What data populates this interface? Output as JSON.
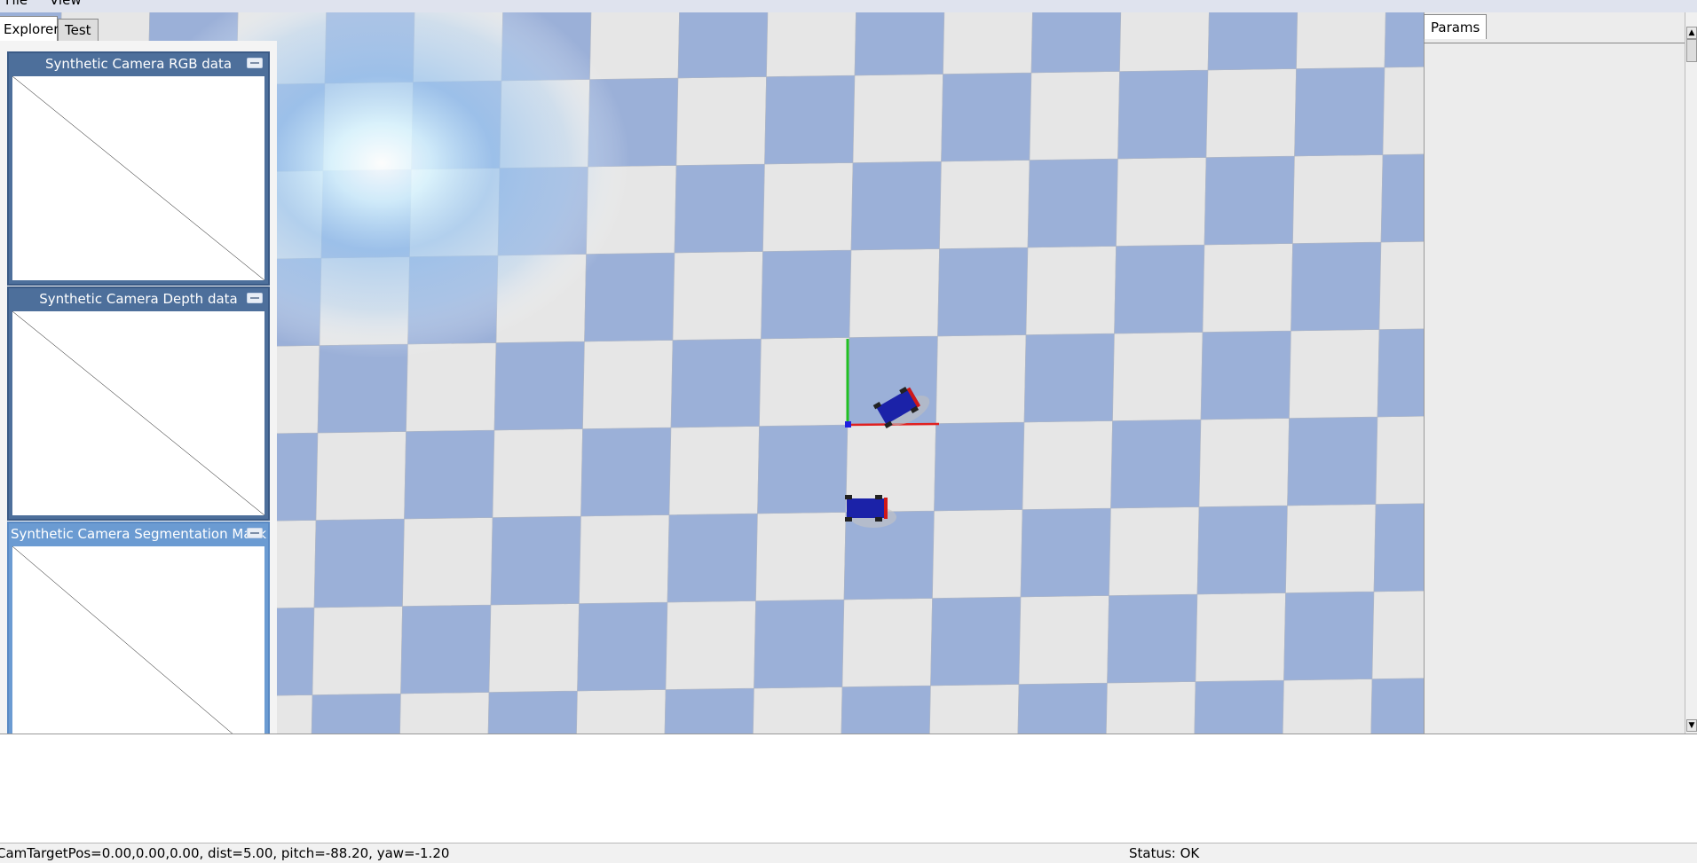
{
  "menu": {
    "items": [
      "File",
      "View"
    ]
  },
  "left_tabs": [
    "Explorer",
    "Test"
  ],
  "right_tabs": [
    "Params"
  ],
  "camera_windows": [
    {
      "title": "Synthetic Camera RGB data"
    },
    {
      "title": "Synthetic Camera Depth data"
    },
    {
      "title": "Synthetic Camera Segmentation Mask"
    }
  ],
  "status": {
    "left": "CamTargetPos=0.00,0.00,0.00, dist=5.00, pitch=-88.20, yaw=-1.20",
    "right": "Status: OK"
  },
  "colors": {
    "floor_light": "#e6e6e6",
    "floor_blue": "#9bb0d8",
    "axis_x": "#e02020",
    "axis_y": "#22c022",
    "axis_z": "#2020e0",
    "robot": "#1b22a8",
    "window_titlebar": "#4d6f9b",
    "window_titlebar_active": "#6b9bd2"
  }
}
